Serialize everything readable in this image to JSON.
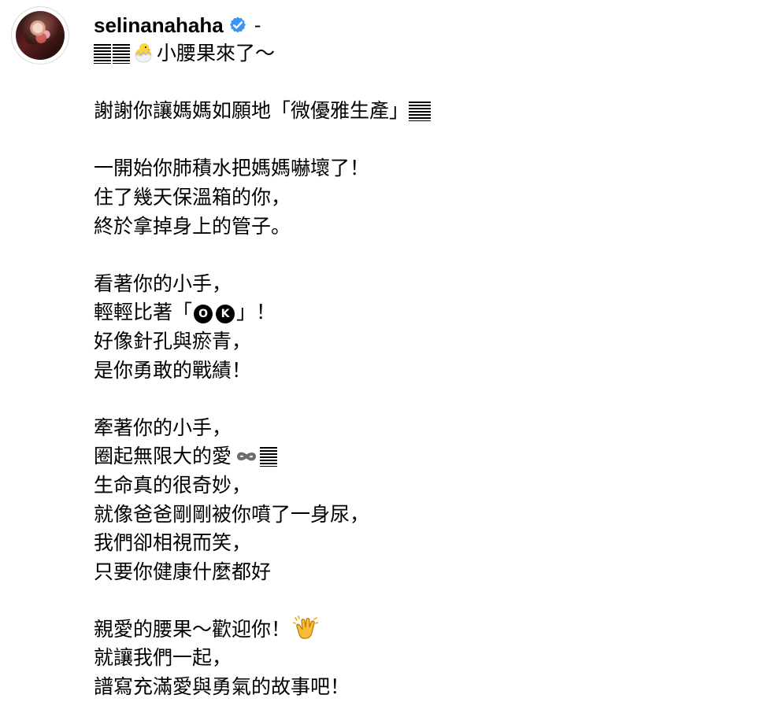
{
  "profile": {
    "username": "selinanahaha",
    "separator": "-"
  },
  "caption": {
    "line_01": "小腰果來了～",
    "line_02": "謝謝你讓媽媽如願地「微優雅生產」",
    "line_03": "一開始你肺積水把媽媽嚇壞了！",
    "line_04": "住了幾天保溫箱的你，",
    "line_05": "終於拿掉身上的管子。",
    "line_06": "看著你的小手，",
    "line_07_before": "輕輕比著「",
    "line_07_ok_1": "O",
    "line_07_ok_2": "K",
    "line_07_after": "」！",
    "line_08": "好像針孔與瘀青，",
    "line_09": "是你勇敢的戰績！",
    "line_10": "牽著你的小手，",
    "line_11": "圈起無限大的愛",
    "line_12": "生命真的很奇妙，",
    "line_13": "就像爸爸剛剛被你噴了一身尿，",
    "line_14": "我們卻相視而笑，",
    "line_15": "只要你健康什麼都好",
    "line_16": "親愛的腰果～歡迎你！",
    "line_17": "就讓我們一起，",
    "line_18": "譜寫充滿愛與勇氣的故事吧！"
  },
  "icons": {
    "verified": "verified-badge-icon",
    "chick": "hatching-chick-icon",
    "ok": "ok-button-icon",
    "infinity": "infinity-icon",
    "clap": "clapping-hands-icon",
    "unsupported": "missing-emoji-icon"
  },
  "colors": {
    "verified": "#3897f0",
    "text": "#000000",
    "background": "#ffffff"
  }
}
